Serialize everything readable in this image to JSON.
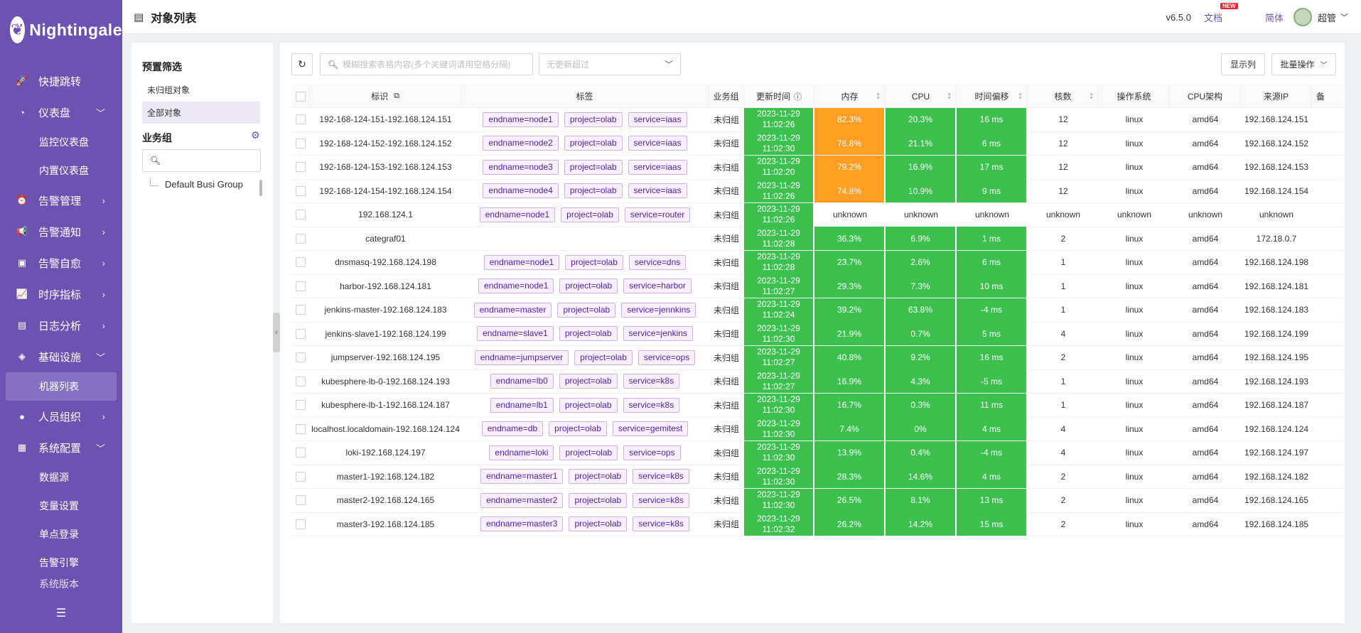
{
  "app": {
    "logo_text": "Nightingale"
  },
  "sidebar": {
    "items": [
      {
        "label": "快捷跳转",
        "icon": "rocket-icon"
      },
      {
        "label": "仪表盘",
        "icon": "dashboard-icon",
        "expanded": true,
        "children": [
          {
            "label": "监控仪表盘"
          },
          {
            "label": "内置仪表盘"
          }
        ]
      },
      {
        "label": "告警管理",
        "icon": "alarm-icon"
      },
      {
        "label": "告警通知",
        "icon": "megaphone-icon"
      },
      {
        "label": "告警自愈",
        "icon": "terminal-icon"
      },
      {
        "label": "时序指标",
        "icon": "chart-icon"
      },
      {
        "label": "日志分析",
        "icon": "log-icon"
      },
      {
        "label": "基础设施",
        "icon": "layers-icon",
        "expanded": true,
        "children": [
          {
            "label": "机器列表",
            "active": true
          }
        ]
      },
      {
        "label": "人员组织",
        "icon": "user-icon"
      },
      {
        "label": "系统配置",
        "icon": "grid-icon",
        "expanded": true,
        "children": [
          {
            "label": "数据源"
          },
          {
            "label": "变量设置"
          },
          {
            "label": "单点登录"
          },
          {
            "label": "告警引擎"
          },
          {
            "label": "系统版本"
          }
        ]
      }
    ]
  },
  "header": {
    "title": "对象列表",
    "version": "v6.5.0",
    "docs_label": "文档",
    "docs_badge": "NEW",
    "lang": "简体",
    "user": "超管"
  },
  "left_panel": {
    "preset_title": "预置筛选",
    "preset_items": [
      "未归组对象",
      "全部对象"
    ],
    "group_title": "业务组",
    "tree_items": [
      "Default Busi Group"
    ]
  },
  "toolbar": {
    "search_placeholder": "模糊搜索表格内容(多个关键词请用空格分隔)",
    "select_placeholder": "无更新超过",
    "show_columns": "显示列",
    "batch_ops": "批量操作"
  },
  "table": {
    "columns": [
      "标识",
      "标签",
      "业务组",
      "更新时间",
      "内存",
      "CPU",
      "时间偏移",
      "核数",
      "操作系统",
      "CPU架构",
      "来源IP",
      "备"
    ],
    "rows": [
      {
        "ident": "192-168-124-151-192.168.124.151",
        "tags": [
          "endname=node1",
          "project=olab",
          "service=iaas"
        ],
        "group": "未归组",
        "date": "2023-11-29",
        "time": "11:02:26",
        "mem": "82.3%",
        "cpu": "20.3%",
        "offset": "16 ms",
        "cores": "12",
        "os": "linux",
        "arch": "amd64",
        "ip": "192.168.124.151"
      },
      {
        "ident": "192-168-124-152-192.168.124.152",
        "tags": [
          "endname=node2",
          "project=olab",
          "service=iaas"
        ],
        "group": "未归组",
        "date": "2023-11-29",
        "time": "11:02:30",
        "mem": "76.8%",
        "cpu": "21.1%",
        "offset": "6 ms",
        "cores": "12",
        "os": "linux",
        "arch": "amd64",
        "ip": "192.168.124.152"
      },
      {
        "ident": "192-168-124-153-192.168.124.153",
        "tags": [
          "endname=node3",
          "project=olab",
          "service=iaas"
        ],
        "group": "未归组",
        "date": "2023-11-29",
        "time": "11:02:20",
        "mem": "79.2%",
        "cpu": "16.9%",
        "offset": "17 ms",
        "cores": "12",
        "os": "linux",
        "arch": "amd64",
        "ip": "192.168.124.153"
      },
      {
        "ident": "192-168-124-154-192.168.124.154",
        "tags": [
          "endname=node4",
          "project=olab",
          "service=iaas"
        ],
        "group": "未归组",
        "date": "2023-11-29",
        "time": "11:02:26",
        "mem": "74.8%",
        "cpu": "10.9%",
        "offset": "9 ms",
        "cores": "12",
        "os": "linux",
        "arch": "amd64",
        "ip": "192.168.124.154"
      },
      {
        "ident": "192.168.124.1",
        "tags": [
          "endname=node1",
          "project=olab",
          "service=router"
        ],
        "group": "未归组",
        "date": "2023-11-29",
        "time": "11:02:26",
        "mem": "unknown",
        "cpu": "unknown",
        "offset": "unknown",
        "cores": "unknown",
        "os": "unknown",
        "arch": "unknown",
        "ip": "unknown"
      },
      {
        "ident": "categraf01",
        "tags": [],
        "group": "未归组",
        "date": "2023-11-29",
        "time": "11:02:28",
        "mem": "36.3%",
        "cpu": "6.9%",
        "offset": "1 ms",
        "cores": "2",
        "os": "linux",
        "arch": "amd64",
        "ip": "172.18.0.7"
      },
      {
        "ident": "dnsmasq-192.168.124.198",
        "tags": [
          "endname=node1",
          "project=olab",
          "service=dns"
        ],
        "group": "未归组",
        "date": "2023-11-29",
        "time": "11:02:28",
        "mem": "23.7%",
        "cpu": "2.6%",
        "offset": "6 ms",
        "cores": "1",
        "os": "linux",
        "arch": "amd64",
        "ip": "192.168.124.198"
      },
      {
        "ident": "harbor-192.168.124.181",
        "tags": [
          "endname=node1",
          "project=olab",
          "service=harbor"
        ],
        "group": "未归组",
        "date": "2023-11-29",
        "time": "11:02:27",
        "mem": "29.3%",
        "cpu": "7.3%",
        "offset": "10 ms",
        "cores": "1",
        "os": "linux",
        "arch": "amd64",
        "ip": "192.168.124.181"
      },
      {
        "ident": "jenkins-master-192.168.124.183",
        "tags": [
          "endname=master",
          "project=olab",
          "service=jennkins"
        ],
        "group": "未归组",
        "date": "2023-11-29",
        "time": "11:02:24",
        "mem": "39.2%",
        "cpu": "63.8%",
        "offset": "-4 ms",
        "cores": "1",
        "os": "linux",
        "arch": "amd64",
        "ip": "192.168.124.183"
      },
      {
        "ident": "jenkins-slave1-192.168.124.199",
        "tags": [
          "endname=slave1",
          "project=olab",
          "service=jenkins"
        ],
        "group": "未归组",
        "date": "2023-11-29",
        "time": "11:02:30",
        "mem": "21.9%",
        "cpu": "0.7%",
        "offset": "5 ms",
        "cores": "4",
        "os": "linux",
        "arch": "amd64",
        "ip": "192.168.124.199"
      },
      {
        "ident": "jumpserver-192.168.124.195",
        "tags": [
          "endname=jumpserver",
          "project=olab",
          "service=ops"
        ],
        "group": "未归组",
        "date": "2023-11-29",
        "time": "11:02:27",
        "mem": "40.8%",
        "cpu": "9.2%",
        "offset": "16 ms",
        "cores": "2",
        "os": "linux",
        "arch": "amd64",
        "ip": "192.168.124.195"
      },
      {
        "ident": "kubesphere-lb-0-192.168.124.193",
        "tags": [
          "endname=lb0",
          "project=olab",
          "service=k8s"
        ],
        "group": "未归组",
        "date": "2023-11-29",
        "time": "11:02:27",
        "mem": "16.9%",
        "cpu": "4.3%",
        "offset": "-5 ms",
        "cores": "1",
        "os": "linux",
        "arch": "amd64",
        "ip": "192.168.124.193"
      },
      {
        "ident": "kubesphere-lb-1-192.168.124.187",
        "tags": [
          "endname=lb1",
          "project=olab",
          "service=k8s"
        ],
        "group": "未归组",
        "date": "2023-11-29",
        "time": "11:02:30",
        "mem": "16.7%",
        "cpu": "0.3%",
        "offset": "11 ms",
        "cores": "1",
        "os": "linux",
        "arch": "amd64",
        "ip": "192.168.124.187"
      },
      {
        "ident": "localhost.localdomain-192.168.124.124",
        "tags": [
          "endname=db",
          "project=olab",
          "service=gemitest"
        ],
        "group": "未归组",
        "date": "2023-11-29",
        "time": "11:02:30",
        "mem": "7.4%",
        "cpu": "0%",
        "offset": "4 ms",
        "cores": "4",
        "os": "linux",
        "arch": "amd64",
        "ip": "192.168.124.124"
      },
      {
        "ident": "loki-192.168.124.197",
        "tags": [
          "endname=loki",
          "project=olab",
          "service=ops"
        ],
        "group": "未归组",
        "date": "2023-11-29",
        "time": "11:02:30",
        "mem": "13.9%",
        "cpu": "0.4%",
        "offset": "-4 ms",
        "cores": "4",
        "os": "linux",
        "arch": "amd64",
        "ip": "192.168.124.197"
      },
      {
        "ident": "master1-192.168.124.182",
        "tags": [
          "endname=master1",
          "project=olab",
          "service=k8s"
        ],
        "group": "未归组",
        "date": "2023-11-29",
        "time": "11:02:30",
        "mem": "28.3%",
        "cpu": "14.6%",
        "offset": "4 ms",
        "cores": "2",
        "os": "linux",
        "arch": "amd64",
        "ip": "192.168.124.182"
      },
      {
        "ident": "master2-192.168.124.165",
        "tags": [
          "endname=master2",
          "project=olab",
          "service=k8s"
        ],
        "group": "未归组",
        "date": "2023-11-29",
        "time": "11:02:30",
        "mem": "26.5%",
        "cpu": "8.1%",
        "offset": "13 ms",
        "cores": "2",
        "os": "linux",
        "arch": "amd64",
        "ip": "192.168.124.165"
      },
      {
        "ident": "master3-192.168.124.185",
        "tags": [
          "endname=master3",
          "project=olab",
          "service=k8s"
        ],
        "group": "未归组",
        "date": "2023-11-29",
        "time": "11:02:32",
        "mem": "26.2%",
        "cpu": "14.2%",
        "offset": "15 ms",
        "cores": "2",
        "os": "linux",
        "arch": "amd64",
        "ip": "192.168.124.185"
      }
    ]
  },
  "colors": {
    "sidebar_bg": "#6c53b1",
    "ok_green": "#3cc14f",
    "warn_orange": "#ff9e22",
    "tag_border": "#d3adf7"
  }
}
